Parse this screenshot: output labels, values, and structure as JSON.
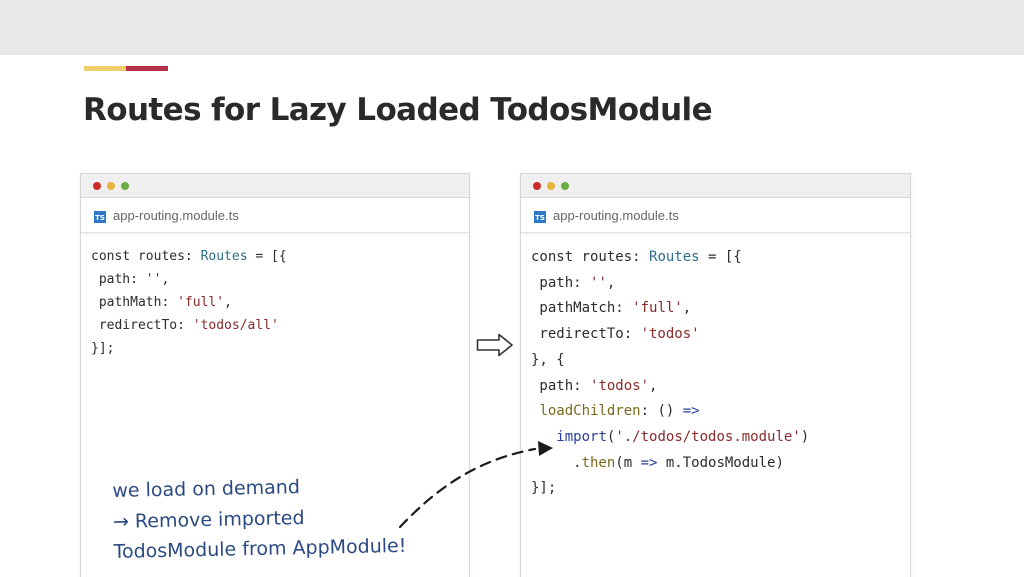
{
  "slide": {
    "title": "Routes for Lazy Loaded TodosModule"
  },
  "colors": {
    "accent_yellow": "#efcf6a",
    "accent_red": "#b5314a",
    "typescript_badge": "#2d79c7",
    "annotation_ink": "#2b4a82"
  },
  "icons": {
    "file_type": "typescript-file-icon",
    "between_panels": "right-arrow-icon",
    "annotation_pointer": "dashed-curved-arrow-icon"
  },
  "left_panel": {
    "tab_label": "app-routing.module.ts",
    "ts_badge": "TS",
    "code": [
      [
        "const routes: ",
        [
          "ty",
          "Routes"
        ],
        " = [{"
      ],
      [
        " path: ",
        [
          "str",
          "''"
        ],
        ","
      ],
      [
        " pathMath: ",
        [
          "str",
          "'full'"
        ],
        ","
      ],
      [
        " redirectTo: ",
        [
          "str",
          "'todos/all'"
        ]
      ],
      [
        "}];"
      ]
    ]
  },
  "right_panel": {
    "tab_label": "app-routing.module.ts",
    "ts_badge": "TS",
    "code": [
      [
        "const routes: ",
        [
          "ty",
          "Routes"
        ],
        " = [{"
      ],
      [
        " path: ",
        [
          "str",
          "''"
        ],
        ","
      ],
      [
        " pathMatch: ",
        [
          "str",
          "'full'"
        ],
        ","
      ],
      [
        " redirectTo: ",
        [
          "str",
          "'todos'"
        ]
      ],
      [
        "}, {"
      ],
      [
        " path: ",
        [
          "str",
          "'todos'"
        ],
        ","
      ],
      [
        " ",
        [
          "fn",
          "loadChildren"
        ],
        ": () ",
        [
          "kw",
          "=>"
        ]
      ],
      [
        "   ",
        [
          "kw",
          "import"
        ],
        "(",
        [
          "str",
          "'./todos/todos.module'"
        ],
        ")"
      ],
      [
        "     .",
        [
          "fn",
          "then"
        ],
        "(m ",
        [
          "kw",
          "=>"
        ],
        " m.TodosModule)"
      ],
      [
        "}];"
      ]
    ]
  },
  "annotation": {
    "lines": [
      "we load on demand",
      "→ Remove imported",
      "TodosModule from AppModule!"
    ]
  }
}
